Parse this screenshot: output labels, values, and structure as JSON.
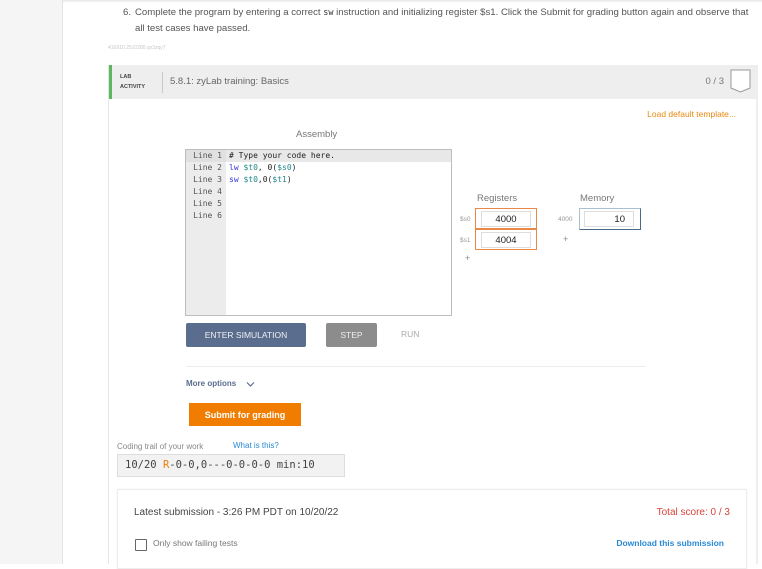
{
  "instruction": {
    "number": "6.",
    "text_before": "Complete the program by entering a correct ",
    "code_word": "sw",
    "text_after": " instruction and initializing register $s1. Click the Submit for grading button again and observe that all test cases have passed."
  },
  "identifier": "416910.2510280.qx3zqy7",
  "lab": {
    "tag_line1": "LAB",
    "tag_line2": "ACTIVITY",
    "title": "5.8.1: zyLab training: Basics",
    "score": "0 / 3",
    "load_template": "Load default template..."
  },
  "assembly": {
    "title": "Assembly",
    "line_labels": [
      "Line 1",
      "Line 2",
      "Line 3",
      "Line 4",
      "Line 5",
      "Line 6"
    ],
    "lines": [
      {
        "parts": [
          {
            "t": "# Type your code here.",
            "c": ""
          }
        ]
      },
      {
        "parts": [
          {
            "t": "lw",
            "c": "kw"
          },
          {
            "t": " ",
            "c": ""
          },
          {
            "t": "$t0",
            "c": "reg"
          },
          {
            "t": ", 0(",
            "c": ""
          },
          {
            "t": "$s0",
            "c": "reg"
          },
          {
            "t": ")",
            "c": ""
          }
        ]
      },
      {
        "parts": [
          {
            "t": "sw",
            "c": "kw"
          },
          {
            "t": " ",
            "c": ""
          },
          {
            "t": "$t0",
            "c": "reg"
          },
          {
            "t": ",0(",
            "c": ""
          },
          {
            "t": "$t1",
            "c": "reg"
          },
          {
            "t": ")",
            "c": ""
          }
        ]
      },
      {
        "parts": []
      },
      {
        "parts": []
      },
      {
        "parts": []
      }
    ]
  },
  "registers": {
    "title": "Registers",
    "items": [
      {
        "name": "$s0",
        "value": "4000"
      },
      {
        "name": "$s1",
        "value": "4004"
      }
    ],
    "add_label": "+"
  },
  "memory": {
    "title": "Memory",
    "items": [
      {
        "address": "4000",
        "value": "10"
      }
    ],
    "add_label": "+"
  },
  "controls": {
    "enter_simulation": "ENTER SIMULATION",
    "step": "STEP",
    "run": "RUN",
    "more_options": "More options",
    "submit": "Submit for grading"
  },
  "trail": {
    "label": "Coding trail of your work",
    "help": "What is this?",
    "prefix": "10/20 ",
    "highlight": "R",
    "rest": "-0-0,0---0-0-0-0 min:10"
  },
  "submission": {
    "title": "Latest submission - 3:26 PM PDT on 10/20/22",
    "total_score": "Total score: 0 / 3",
    "only_failing": "Only show failing tests",
    "download": "Download this submission"
  }
}
